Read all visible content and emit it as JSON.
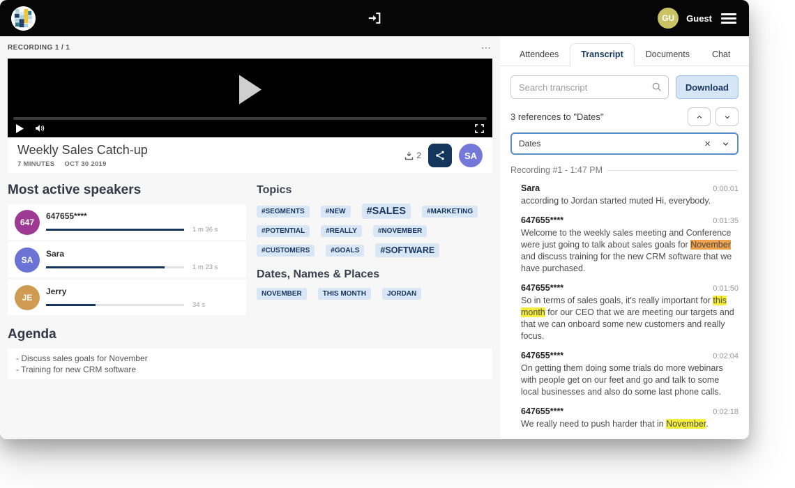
{
  "topbar": {
    "user_initials": "GU",
    "user_name": "Guest"
  },
  "left": {
    "recording_label": "RECORDING 1 / 1",
    "more_label": "⋯",
    "title": "Weekly Sales Catch-up",
    "duration_label": "7 MINUTES",
    "date_label": "OCT 30 2019",
    "download_count": "2",
    "owner_initials": "SA",
    "speakers_heading": "Most active speakers",
    "speakers": [
      {
        "initials": "647",
        "color": "#9e3a93",
        "name": "647655****",
        "time": "1 m 36 s",
        "pct": 100
      },
      {
        "initials": "SA",
        "color": "#6b74d6",
        "name": "Sara",
        "time": "1 m 23 s",
        "pct": 86
      },
      {
        "initials": "JE",
        "color": "#cf9a52",
        "name": "Jerry",
        "time": "34 s",
        "pct": 36
      }
    ],
    "topics_heading": "Topics",
    "topics": [
      {
        "label": "#SEGMENTS",
        "size": "s"
      },
      {
        "label": "#NEW",
        "size": "s"
      },
      {
        "label": "#SALES",
        "size": "l"
      },
      {
        "label": "#MARKETING",
        "size": "s"
      },
      {
        "label": "#POTENTIAL",
        "size": "s"
      },
      {
        "label": "#REALLY",
        "size": "s"
      },
      {
        "label": "#NOVEMBER",
        "size": "s"
      },
      {
        "label": "#CUSTOMERS",
        "size": "s"
      },
      {
        "label": "#GOALS",
        "size": "s"
      },
      {
        "label": "#SOFTWARE",
        "size": "m"
      }
    ],
    "dates_heading": "Dates, Names & Places",
    "dates_tags": [
      "NOVEMBER",
      "THIS MONTH",
      "JORDAN"
    ],
    "agenda_heading": "Agenda",
    "agenda_items": [
      "- Discuss sales goals for November",
      "- Training for new CRM software"
    ]
  },
  "right": {
    "tabs": [
      {
        "label": "Attendees",
        "active": false
      },
      {
        "label": "Transcript",
        "active": true
      },
      {
        "label": "Documents",
        "active": false
      },
      {
        "label": "Chat",
        "active": false
      }
    ],
    "search_placeholder": "Search transcript",
    "download_label": "Download",
    "references_text": "3 references to \"Dates\"",
    "filter_value": "Dates",
    "recording_header": "Recording #1 - 1:47 PM",
    "entries": [
      {
        "speaker": "Sara",
        "time": "0:00:01",
        "segments": [
          {
            "text": "according to Jordan started muted Hi, everybody.",
            "hl": "none"
          }
        ]
      },
      {
        "speaker": "647655****",
        "time": "0:01:35",
        "segments": [
          {
            "text": "Welcome to the weekly sales meeting and Conference were just going to talk about sales goals for ",
            "hl": "none"
          },
          {
            "text": "November",
            "hl": "orange"
          },
          {
            "text": " and discuss training for the new CRM software that we have purchased.",
            "hl": "none"
          }
        ]
      },
      {
        "speaker": "647655****",
        "time": "0:01:50",
        "segments": [
          {
            "text": "So in terms of sales goals, it's really important for ",
            "hl": "none"
          },
          {
            "text": "this month",
            "hl": "yellow"
          },
          {
            "text": " for our CEO that we are meeting our targets and that we can onboard some new customers and really focus.",
            "hl": "none"
          }
        ]
      },
      {
        "speaker": "647655****",
        "time": "0:02:04",
        "segments": [
          {
            "text": "On getting them doing some trials do more webinars with people get on our feet and go and talk to some local businesses and also do some last phone calls.",
            "hl": "none"
          }
        ]
      },
      {
        "speaker": "647655****",
        "time": "0:02:18",
        "segments": [
          {
            "text": "We really need to push harder that in ",
            "hl": "none"
          },
          {
            "text": "November",
            "hl": "yellow"
          },
          {
            "text": ".",
            "hl": "none"
          }
        ]
      }
    ]
  },
  "colors": {
    "accent_navy": "#16365e",
    "tag_bg": "#d8e6f5",
    "highlight_orange": "#f0a14b",
    "highlight_yellow": "#f5ee3a",
    "guest_avatar": "#c9c364",
    "owner_avatar": "#7478d8",
    "share_button": "#14355c",
    "bar_fill": "#16365e"
  }
}
